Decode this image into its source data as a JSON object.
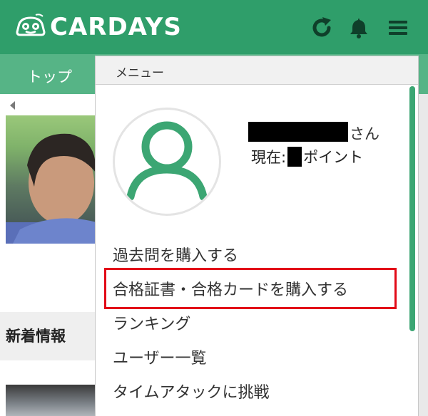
{
  "header": {
    "logo_text": "CARDAYS",
    "brand_color": "#2f9e6a",
    "icons": [
      "refresh-icon",
      "bell-icon",
      "hamburger-menu-icon"
    ]
  },
  "nav": {
    "top_label": "トップ"
  },
  "background": {
    "news_title": "新着情報"
  },
  "menu": {
    "heading": "メニュー",
    "user": {
      "name_suffix": "さん",
      "points_prefix": "現在:",
      "points_suffix": "ポイント"
    },
    "items": [
      {
        "label": "過去問を購入する"
      },
      {
        "label": "合格証書・合格カードを購入する",
        "highlighted": true
      },
      {
        "label": "ランキング"
      },
      {
        "label": "ユーザー一覧"
      },
      {
        "label": "タイムアタックに挑戦"
      }
    ],
    "highlight_color": "#e20a17",
    "accent_color": "#3ca673"
  }
}
